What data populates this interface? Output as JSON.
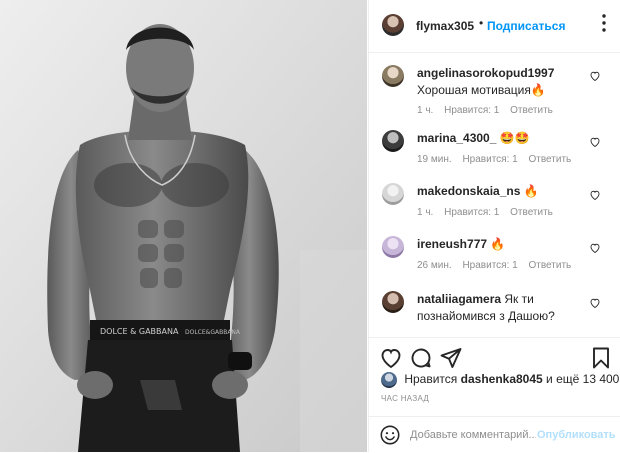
{
  "post": {
    "author": "flymax305",
    "separator": "•",
    "follow_label": "Подписаться",
    "more_icon": "more-options-icon",
    "photo_alt": "photo",
    "waistband_text_1": "DOLCE & GABBANA",
    "waistband_text_2": "DOLCE&GABBANA"
  },
  "comments": [
    {
      "user": "angelinasorokopud1997",
      "text": "Хорошая мотивация🔥",
      "time": "1 ч.",
      "likes": "Нравится: 1",
      "reply": "Ответить",
      "avatar_color": "#8a7a62"
    },
    {
      "user": "marina_4300_",
      "text": "🤩🤩",
      "time": "19 мин.",
      "likes": "Нравится: 1",
      "reply": "Ответить",
      "avatar_color": "#3c3c3c"
    },
    {
      "user": "makedonskaia_ns",
      "text": "🔥",
      "time": "1 ч.",
      "likes": "Нравится: 1",
      "reply": "Ответить",
      "avatar_color": "#d6d6d6"
    },
    {
      "user": "ireneush777",
      "text": "🔥",
      "time": "26 мин.",
      "likes": "Нравится: 1",
      "reply": "Ответить",
      "avatar_color": "#c8b6d8"
    },
    {
      "user": "nataliiagamera",
      "text": "Як ти познайомився з Дашою?",
      "time": "",
      "likes": "",
      "reply": "",
      "avatar_color": "#5a4032"
    }
  ],
  "actions": {
    "like_icon": "heart-icon",
    "comment_icon": "comment-icon",
    "share_icon": "share-icon",
    "save_icon": "bookmark-icon"
  },
  "likes_bar": {
    "prefix": "Нравится",
    "user": "dashenka8045",
    "suffix": "и ещё 13 400"
  },
  "time_ago": "час назад",
  "add_comment": {
    "placeholder": "Добавьте комментарий...",
    "publish_label": "Опубликовать"
  },
  "colors": {
    "link_blue": "#0095f6",
    "publish_disabled": "#b2dffc",
    "muted": "#8e8e8e"
  }
}
